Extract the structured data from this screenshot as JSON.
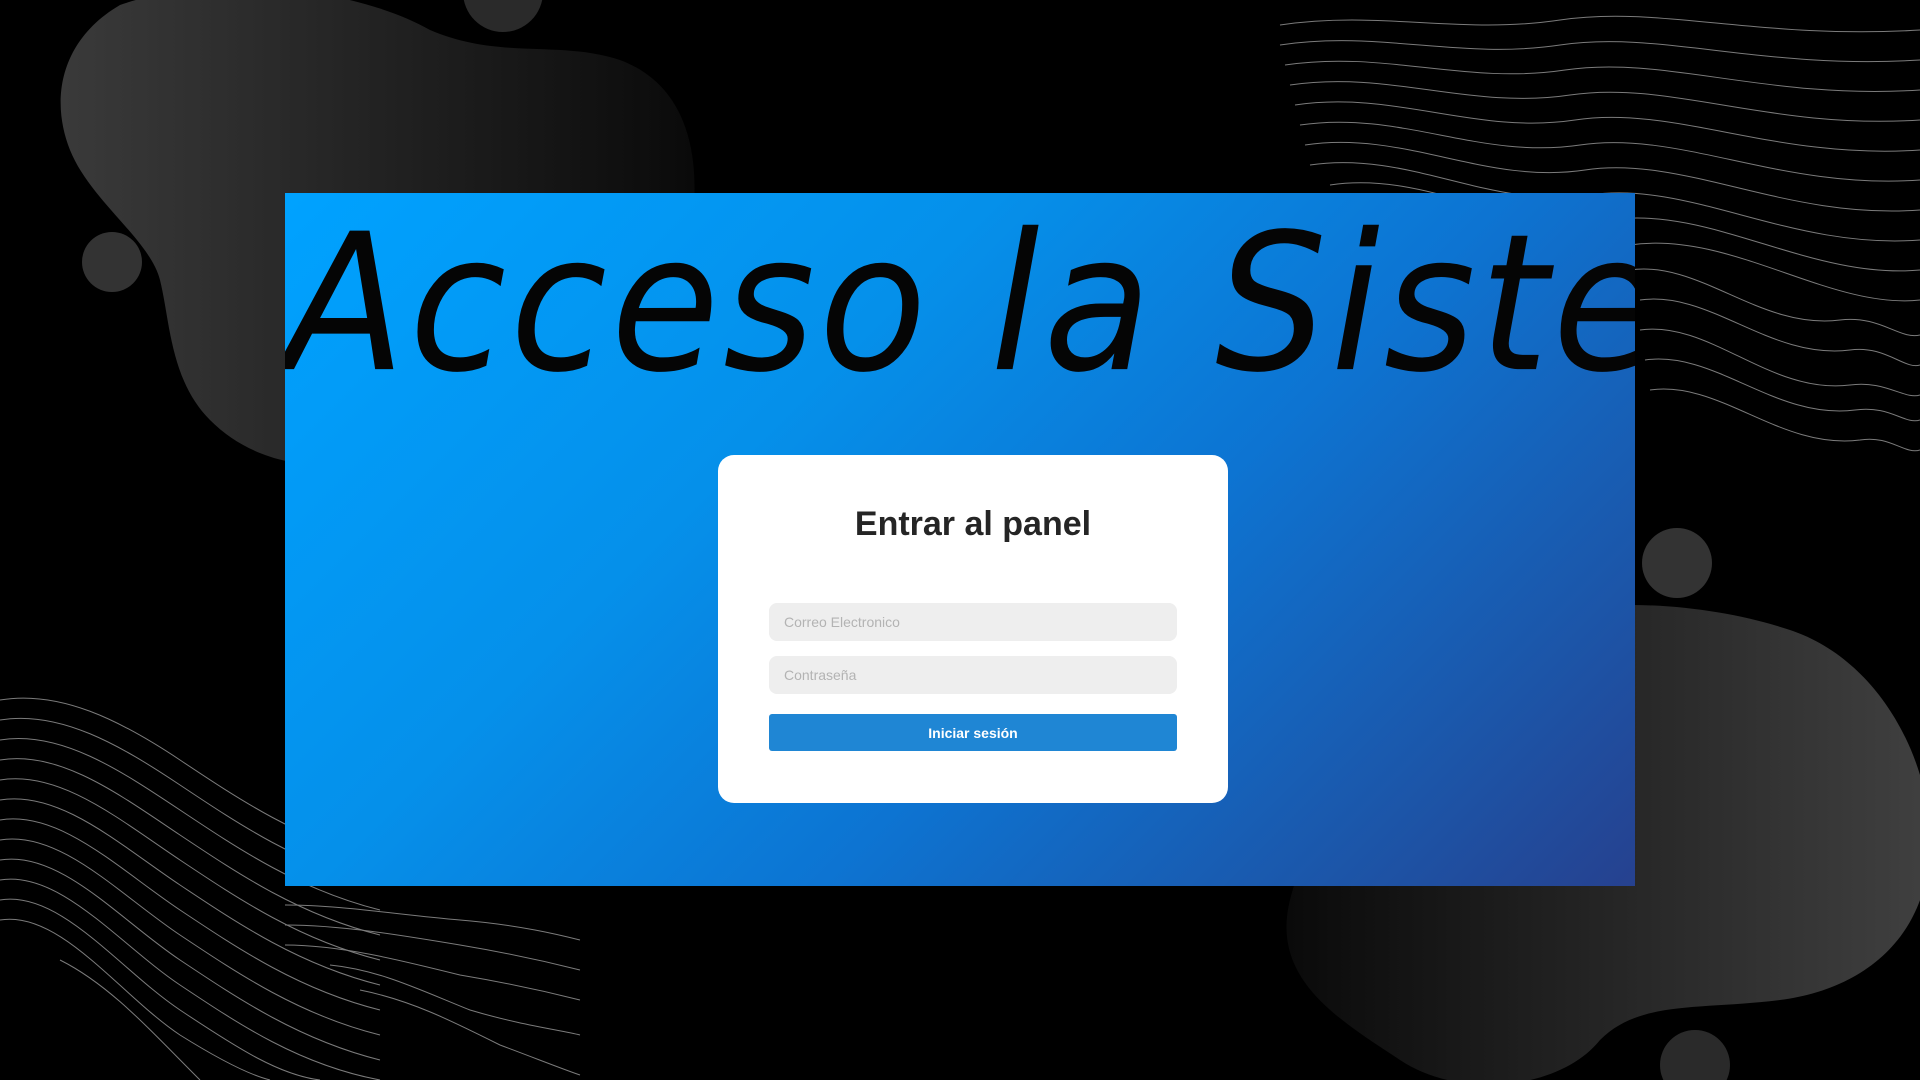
{
  "page": {
    "title": "Acceso la Sistema"
  },
  "login": {
    "heading": "Entrar al panel",
    "email_placeholder": "Correo Electronico",
    "email_value": "",
    "password_placeholder": "Contraseña",
    "password_value": "",
    "submit_label": "Iniciar sesión"
  },
  "colors": {
    "background": "#000000",
    "gradient_start": "#00a2ff",
    "gradient_end": "#26418f",
    "card": "#ffffff",
    "button": "#1f86d4",
    "field": "#eeeeee"
  }
}
